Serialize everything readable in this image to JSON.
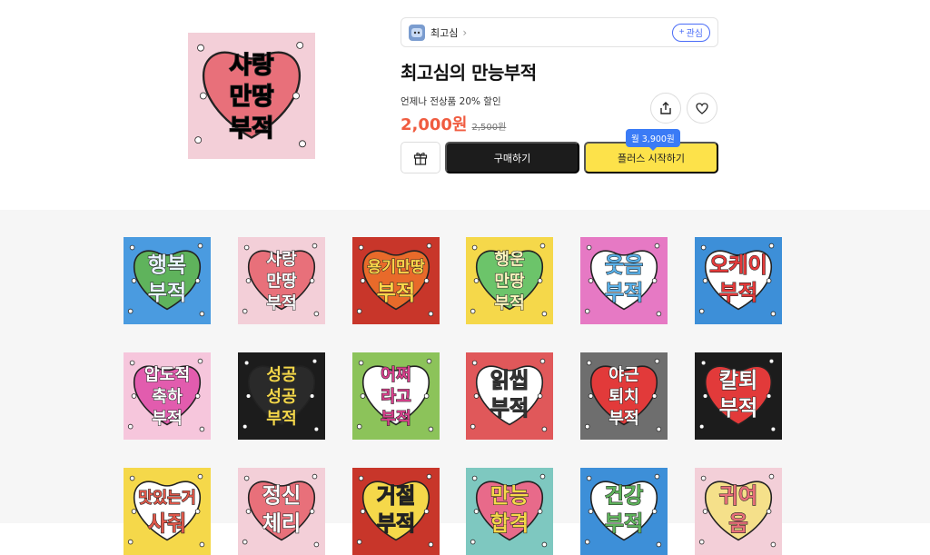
{
  "artist": {
    "name": "최고심",
    "follow_label": "관심"
  },
  "product": {
    "title": "최고심의 만능부적",
    "promo": "언제나 전상품 20% 할인",
    "price": "2,000원",
    "original_price": "2,500원"
  },
  "actions": {
    "buy_label": "구매하기",
    "plus_label": "플러스 시작하기",
    "plus_tooltip": "월 3,900원",
    "share_icon": "share-icon",
    "heart_icon": "heart-icon",
    "gift_icon": "gift-icon"
  },
  "colors": {
    "price": "#f05c40",
    "plus_button": "#fde24a",
    "buy_button": "#1c1c1c",
    "accent": "#4a6cf7",
    "tooltip": "#3a7bf6"
  },
  "hero": {
    "lines": [
      "사랑",
      "만땅",
      "부적"
    ],
    "bg": "#f3cfd8",
    "blob": "#e8707a"
  },
  "stickers": [
    {
      "lines": [
        "행복",
        "부적"
      ],
      "bg": "#4a9be0",
      "blob": "#5fb35c",
      "text": "#e9f4ff"
    },
    {
      "lines": [
        "사랑",
        "만땅",
        "부적"
      ],
      "bg": "#f3cfd8",
      "blob": "#e8707a",
      "text": "#ffffff"
    },
    {
      "lines": [
        "용기만땅",
        "부적"
      ],
      "bg": "#c8362a",
      "blob": "#e86a2a",
      "text": "#ffd64a"
    },
    {
      "lines": [
        "행운",
        "만땅",
        "부적"
      ],
      "bg": "#f5d84a",
      "blob": "#6cc46a",
      "text": "#fff7c0"
    },
    {
      "lines": [
        "웃음",
        "부적"
      ],
      "bg": "#e679c4",
      "blob": "#ffffff",
      "text": "#5ab0e8"
    },
    {
      "lines": [
        "오케이",
        "부적"
      ],
      "bg": "#3d8fd8",
      "blob": "#ffffff",
      "text": "#e33a3a"
    },
    {
      "lines": [
        "압도적",
        "축하",
        "부적"
      ],
      "bg": "#f6c6dc",
      "blob": "#e25cae",
      "text": "#ffffff"
    },
    {
      "lines": [
        "성공",
        "성공",
        "부적"
      ],
      "bg": "#1c1c1c",
      "blob": "#2a2a2a",
      "text": "#f3d64a"
    },
    {
      "lines": [
        "어쩌",
        "라고",
        "부적"
      ],
      "bg": "#8cc35a",
      "blob": "#ffffff",
      "text": "#d8408c"
    },
    {
      "lines": [
        "읽씹",
        "부적"
      ],
      "bg": "#e0585a",
      "blob": "#ffffff",
      "text": "#333333"
    },
    {
      "lines": [
        "야근",
        "퇴치",
        "부적"
      ],
      "bg": "#6e6e6e",
      "blob": "#e23a3a",
      "text": "#ffffff"
    },
    {
      "lines": [
        "칼퇴",
        "부적"
      ],
      "bg": "#1c1c1c",
      "blob": "#e23a3a",
      "text": "#ffffff"
    },
    {
      "lines": [
        "맛있는거",
        "사줘"
      ],
      "bg": "#f5d84a",
      "blob": "#ffffff",
      "text": "#e0584a"
    },
    {
      "lines": [
        "정신",
        "체리"
      ],
      "bg": "#f3cfd8",
      "blob": "#e8707a",
      "text": "#ffffff"
    },
    {
      "lines": [
        "거절",
        "부적"
      ],
      "bg": "#c8362a",
      "blob": "#f5d84a",
      "text": "#222222"
    },
    {
      "lines": [
        "만능",
        "합격"
      ],
      "bg": "#7ec8c0",
      "blob": "#e86a8a",
      "text": "#f5d84a"
    },
    {
      "lines": [
        "건강",
        "부적"
      ],
      "bg": "#3d8fd8",
      "blob": "#ffffff",
      "text": "#5fb35c"
    },
    {
      "lines": [
        "귀여",
        "움"
      ],
      "bg": "#f3cfd8",
      "blob": "#f5e08a",
      "text": "#e8707a"
    }
  ]
}
